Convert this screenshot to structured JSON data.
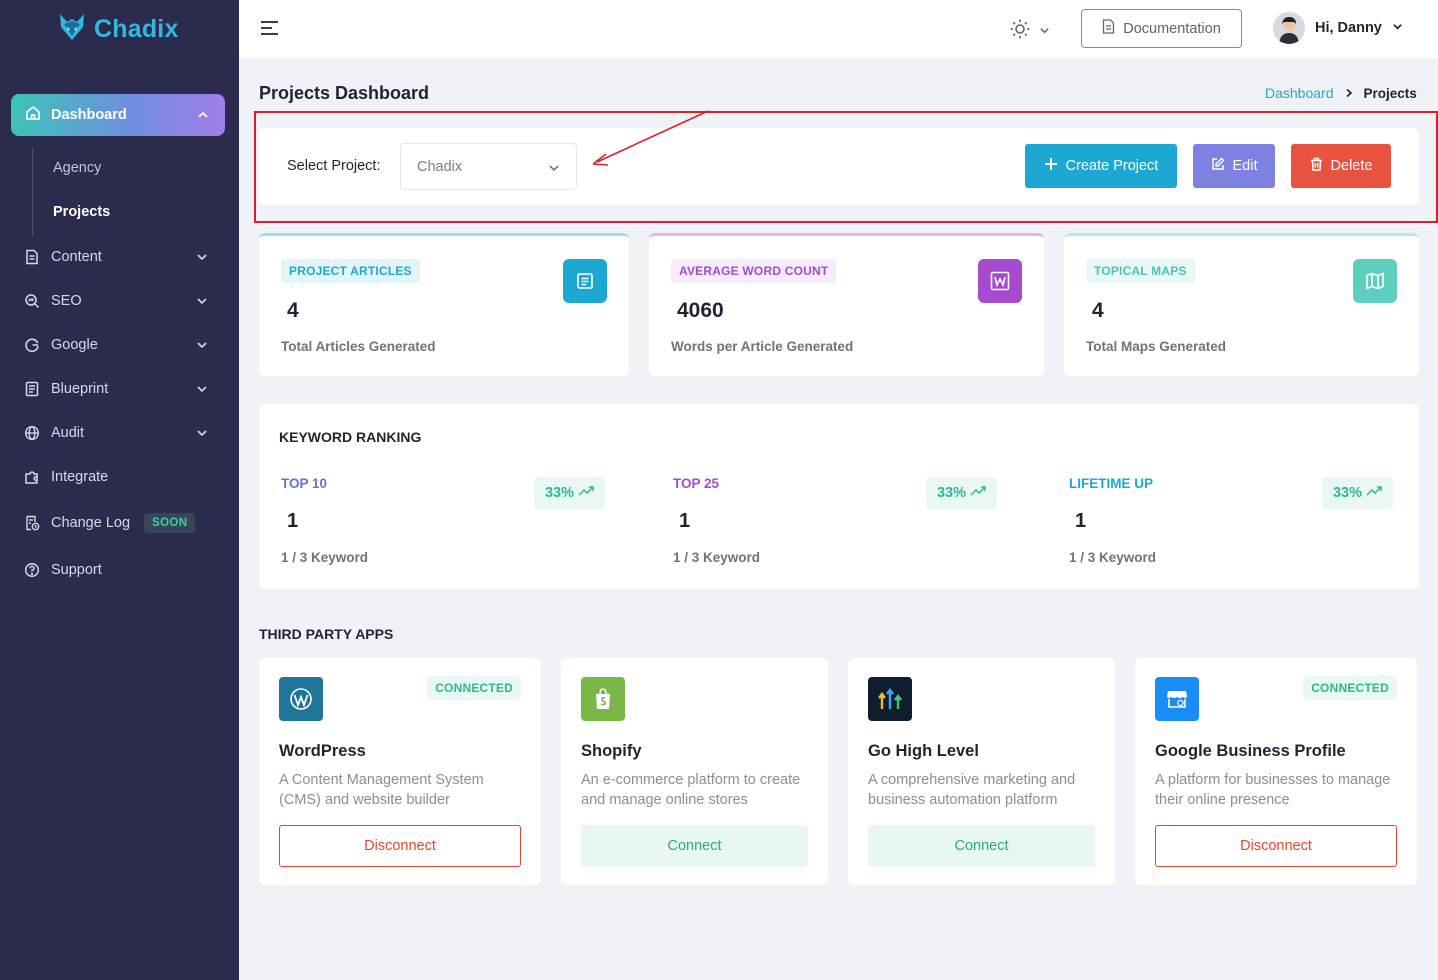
{
  "brand": {
    "name": "Chadix"
  },
  "sidebar": {
    "active": {
      "label": "Dashboard"
    },
    "sub_items": [
      {
        "label": "Agency",
        "active": false
      },
      {
        "label": "Projects",
        "active": true
      }
    ],
    "items": [
      {
        "label": "Content",
        "icon": "content-icon",
        "has_chevron": true
      },
      {
        "label": "SEO",
        "icon": "seo-icon",
        "has_chevron": true
      },
      {
        "label": "Google",
        "icon": "google-icon",
        "has_chevron": true
      },
      {
        "label": "Blueprint",
        "icon": "blueprint-icon",
        "has_chevron": true
      },
      {
        "label": "Audit",
        "icon": "globe-icon",
        "has_chevron": true
      },
      {
        "label": "Integrate",
        "icon": "integrate-icon",
        "has_chevron": false
      },
      {
        "label": "Change Log",
        "icon": "change-log-icon",
        "has_chevron": false,
        "badge": "SOON"
      },
      {
        "label": "Support",
        "icon": "support-icon",
        "has_chevron": false
      }
    ]
  },
  "topbar": {
    "documentation_label": "Documentation",
    "greeting": "Hi, Danny"
  },
  "page": {
    "title": "Projects Dashboard",
    "breadcrumb": {
      "parent": "Dashboard",
      "current": "Projects"
    }
  },
  "project_selector": {
    "label": "Select Project:",
    "selected": "Chadix",
    "create_label": "Create Project",
    "edit_label": "Edit",
    "delete_label": "Delete"
  },
  "stats": [
    {
      "badge": "PROJECT ARTICLES",
      "value": "4",
      "subtitle": "Total Articles Generated",
      "color": "#1ca8d2",
      "badge_bg": "#e4f5fa",
      "icon": "article-icon"
    },
    {
      "badge": "AVERAGE WORD COUNT",
      "value": "4060",
      "subtitle": "Words per Article Generated",
      "color": "#a64bd0",
      "badge_bg": "#f6ecfb",
      "icon": "word-icon"
    },
    {
      "badge": "TOPICAL MAPS",
      "value": "4",
      "subtitle": "Total Maps Generated",
      "color": "#5ccfc1",
      "badge_bg": "#e9f8f6",
      "icon": "map-icon"
    }
  ],
  "keyword_ranking": {
    "title": "KEYWORD RANKING",
    "items": [
      {
        "label": "TOP 10",
        "value": "1",
        "subtitle": "1 / 3 Keyword",
        "change": "33%",
        "color": "#6a70d8"
      },
      {
        "label": "TOP 25",
        "value": "1",
        "subtitle": "1 / 3 Keyword",
        "change": "33%",
        "color": "#a64bd0"
      },
      {
        "label": "LIFETIME UP",
        "value": "1",
        "subtitle": "1 / 3 Keyword",
        "change": "33%",
        "color": "#1ca8d2"
      }
    ]
  },
  "third_party": {
    "title": "THIRD PARTY APPS",
    "apps": [
      {
        "name": "WordPress",
        "desc": "A Content Management System (CMS) and website builder",
        "status": "CONNECTED",
        "action": "Disconnect",
        "icon": "wordpress-icon"
      },
      {
        "name": "Shopify",
        "desc": "An e-commerce platform to create and manage online stores",
        "status": "",
        "action": "Connect",
        "icon": "shopify-icon"
      },
      {
        "name": "Go High Level",
        "desc": "A comprehensive marketing and business automation platform",
        "status": "",
        "action": "Connect",
        "icon": "gohighlevel-icon"
      },
      {
        "name": "Google Business Profile",
        "desc": "A platform for businesses to manage their online presence",
        "status": "CONNECTED",
        "action": "Disconnect",
        "icon": "google-business-icon"
      }
    ]
  }
}
